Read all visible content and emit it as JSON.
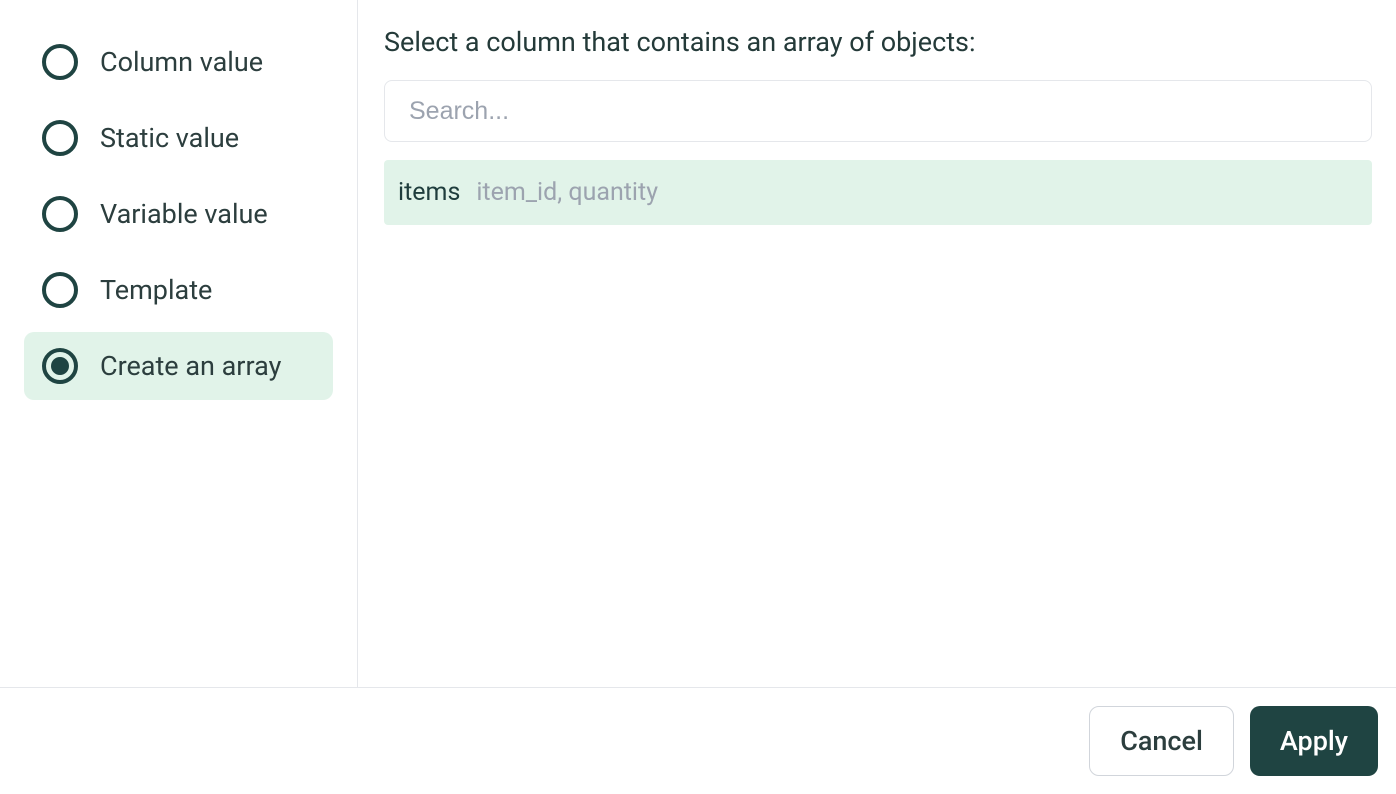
{
  "sidebar": {
    "options": [
      {
        "label": "Column value",
        "selected": false
      },
      {
        "label": "Static value",
        "selected": false
      },
      {
        "label": "Variable value",
        "selected": false
      },
      {
        "label": "Template",
        "selected": false
      },
      {
        "label": "Create an array",
        "selected": true
      }
    ]
  },
  "content": {
    "heading": "Select a column that contains an array of objects:",
    "search_placeholder": "Search...",
    "columns": [
      {
        "name": "items",
        "fields": "item_id, quantity"
      }
    ]
  },
  "footer": {
    "cancel_label": "Cancel",
    "apply_label": "Apply"
  }
}
